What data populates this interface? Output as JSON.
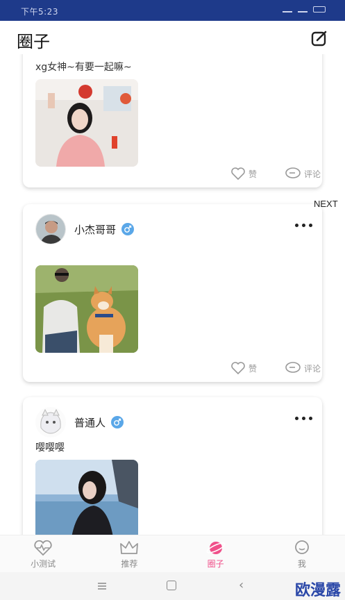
{
  "status_bar": {
    "time": "下午5:23"
  },
  "header": {
    "title": "圈子"
  },
  "posts": [
    {
      "text": "xg女神~有要一起嘛~",
      "like_label": "赞",
      "comment_label": "评论"
    },
    {
      "author": "小杰哥哥",
      "like_label": "赞",
      "comment_label": "评论"
    },
    {
      "author": "普通人",
      "text": "嘤嘤嘤"
    }
  ],
  "next_label": "NEXT",
  "tabs": [
    {
      "label": "小测试",
      "icon": "heartbeat-icon"
    },
    {
      "label": "推荐",
      "icon": "crown-icon"
    },
    {
      "label": "圈子",
      "icon": "planet-icon",
      "active": true
    },
    {
      "label": "我",
      "icon": "chat-bubble-icon"
    }
  ],
  "colors": {
    "status_bar": "#1e3a8a",
    "accent": "#f0508a",
    "badge": "#5aa7e8"
  },
  "watermark": "欧漫露"
}
